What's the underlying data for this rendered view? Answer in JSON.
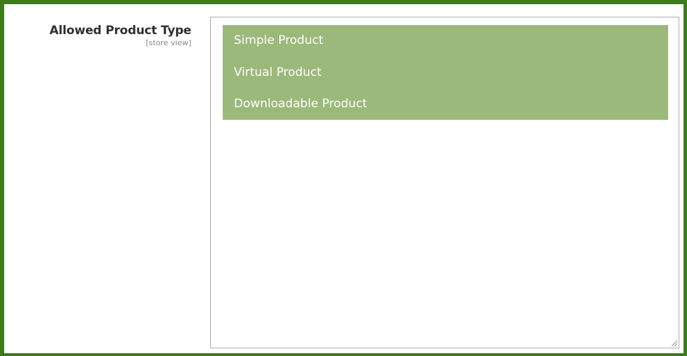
{
  "field": {
    "label": "Allowed Product Type",
    "scope": "[store view]"
  },
  "multiselect": {
    "options": [
      {
        "label": "Simple Product",
        "selected": true
      },
      {
        "label": "Virtual Product",
        "selected": true
      },
      {
        "label": "Downloadable Product",
        "selected": true
      }
    ]
  },
  "colors": {
    "frame_border": "#3c7a1d",
    "selected_bg": "#9bb97b",
    "selected_text": "#ffffff",
    "label_text": "#303030",
    "scope_text": "#8a8a8a"
  },
  "icons": {
    "resize": "resize-handle-icon"
  }
}
